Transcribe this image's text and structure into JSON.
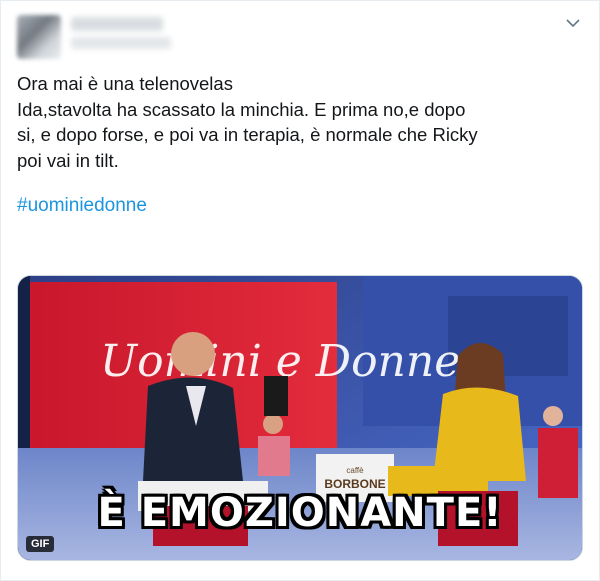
{
  "tweet": {
    "text_lines": [
      "Ora mai è una telenovelas",
      "Ida,stavolta ha scassato la minchia. E prima no,e dopo",
      "si, e dopo forse, e poi va in terapia, è normale che Ricky",
      "poi vai in tilt."
    ],
    "hashtag": "#uominiedonne",
    "icons": {
      "menu": "chevron-down-icon"
    },
    "colors": {
      "hashtag": "#1b95e0",
      "text": "#14171a"
    }
  },
  "media": {
    "type": "gif",
    "badge": "GIF",
    "caption": "È EMOZIONANTE!",
    "show_logo": "Uomini e Donne",
    "sponsor_sign": "BORBONE",
    "sponsor_small": "caffè"
  }
}
